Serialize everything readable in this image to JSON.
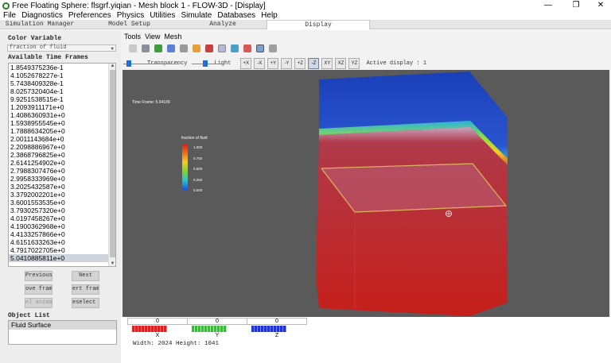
{
  "window": {
    "title": "Free Floating Sphere: flsgrf.yiqian  -  Mesh block 1 - FLOW-3D - [Display]",
    "minimize": "—",
    "maximize": "❐",
    "close": "✕"
  },
  "menubar": [
    "File",
    "Diagnostics",
    "Preferences",
    "Physics",
    "Utilities",
    "Simulate",
    "Databases",
    "Help"
  ],
  "tabs": [
    {
      "label": "Simulation Manager"
    },
    {
      "label": "Model Setup"
    },
    {
      "label": "Analyze"
    },
    {
      "label": "Display",
      "active": true
    }
  ],
  "left_panel": {
    "color_variable_label": "Color Variable",
    "color_variable_value": "fraction of fluid",
    "time_frames_label": "Available Time Frames",
    "time_frames": [
      "1.8549375236e-1",
      "4.1052678227e-1",
      "5.7438409328e-1",
      "8.0257320404e-1",
      "9.9251538515e-1",
      "1.2093911171e+0",
      "1.4086360931e+0",
      "1.5938955545e+0",
      "1.7888634205e+0",
      "2.0011143684e+0",
      "2.2098886967e+0",
      "2.3868796825e+0",
      "2.6141254902e+0",
      "2.7988307476e+0",
      "2.9958333969e+0",
      "3.2025432587e+0",
      "3.3792002201e+0",
      "3.6001553535e+0",
      "3.7930257320e+0",
      "4.0197458267e+0",
      "4.1900362968e+0",
      "4.4133257866e+0",
      "4.6151633263e+0",
      "4.7917022705e+0",
      "5.0410885811e+0"
    ],
    "selected_frame": "5.0410885811e+0",
    "buttons": {
      "previous": "Previous",
      "next": "Next",
      "remove_frame": "ove frame",
      "insert_frame": "ert frame",
      "select_animation": "el animat",
      "deselect_all": "eselect al"
    },
    "object_list_label": "Object List",
    "object_list": [
      "Fluid Surface"
    ]
  },
  "display": {
    "menu": [
      "Tools",
      "View",
      "Mesh"
    ],
    "transparency_label": "Transparency",
    "light_label": "Light",
    "view_buttons": [
      "+X",
      "-X",
      "+Y",
      "-Y",
      "+Z",
      "-Z",
      "XY",
      "XZ",
      "YZ"
    ],
    "active_display": "Active display : 1",
    "time_frame_text": "Time Frame:  5.04109",
    "legend_title": "fraction of fluid",
    "legend_values": [
      "1.000",
      "0.750",
      "0.500",
      "0.250",
      "0.000"
    ],
    "colors": {
      "fluid": "#d8241e",
      "air": "#1e3ec4",
      "background": "#5a5a5a",
      "panel": "#ededed"
    }
  },
  "bottom": {
    "axes": [
      {
        "value": "0",
        "label": "X",
        "color": "#e02020"
      },
      {
        "value": "0",
        "label": "Y",
        "color": "#2fc22f"
      },
      {
        "value": "0",
        "label": "Z",
        "color": "#2033d6"
      }
    ],
    "dimensions": "Width: 2024 Height: 1041"
  }
}
